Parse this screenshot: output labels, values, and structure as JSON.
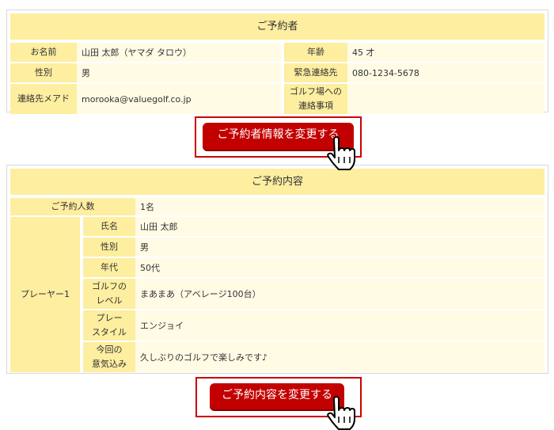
{
  "booker": {
    "title": "ご予約者",
    "name_label": "お名前",
    "name_value": "山田 太郎（ヤマダ タロウ）",
    "age_label": "年齢",
    "age_value": "45 才",
    "gender_label": "性別",
    "gender_value": "男",
    "emergency_label": "緊急連絡先",
    "emergency_value": "080-1234-5678",
    "email_label": "連絡先メアド",
    "email_value": "morooka@valuegolf.co.jp",
    "note_label_1": "ゴルフ場への",
    "note_label_2": "連絡事項",
    "note_value": "",
    "change_button": "ご予約者情報を変更する"
  },
  "reservation": {
    "title": "ご予約内容",
    "count_label": "ご予約人数",
    "count_value": "1名",
    "player_label": "プレーヤー1",
    "fullname_label": "氏名",
    "fullname_value": "山田 太郎",
    "gender_label": "性別",
    "gender_value": "男",
    "age_label": "年代",
    "age_value": "50代",
    "level_label_1": "ゴルフの",
    "level_label_2": "レベル",
    "level_value": "まあまあ（アベレージ100台）",
    "style_label_1": "プレー",
    "style_label_2": "スタイル",
    "style_value": "エンジョイ",
    "motivation_label_1": "今回の",
    "motivation_label_2": "意気込み",
    "motivation_value": "久しぶりのゴルフで楽しみです♪",
    "change_button": "ご予約内容を変更する"
  },
  "colors": {
    "label_bg": "#fdeea0",
    "value_bg": "#fffbe5",
    "button_bg": "#c30000",
    "highlight_border": "#cc0000"
  },
  "icons": {
    "cursor": "pointer-hand-icon"
  }
}
